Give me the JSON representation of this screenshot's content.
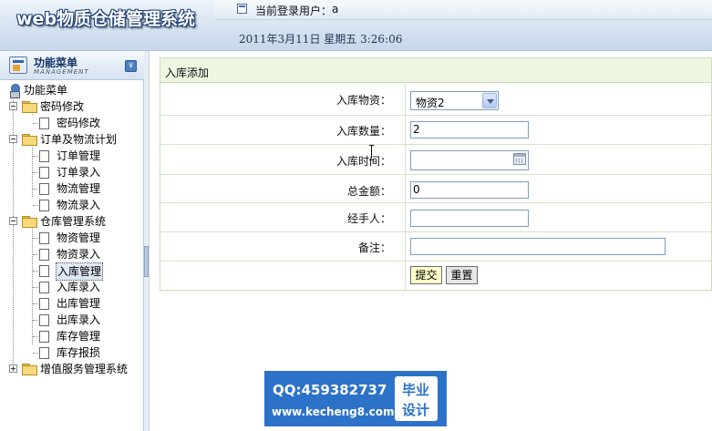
{
  "header": {
    "app_title": "web物质仓储管理系统",
    "current_user_label": "当前登录用户：",
    "current_user": "a",
    "datetime": "2011年3月11日  星期五  3:26:06"
  },
  "sidebar": {
    "menu_title": "功能菜单",
    "menu_subtitle": "MANAGEMENT",
    "collapse_icon": "double-chevron-down-icon",
    "tree": {
      "root": "功能菜单",
      "groups": [
        {
          "label": "密码修改",
          "expanded": true,
          "items": [
            "密码修改"
          ]
        },
        {
          "label": "订单及物流计划",
          "expanded": true,
          "items": [
            "订单管理",
            "订单录入",
            "物流管理",
            "物流录入"
          ]
        },
        {
          "label": "仓库管理系统",
          "expanded": true,
          "items": [
            "物资管理",
            "物资录入",
            "入库管理",
            "入库录入",
            "出库管理",
            "出库录入",
            "库存管理",
            "库存报损"
          ],
          "selected_item": "入库管理"
        },
        {
          "label": "增值服务管理系统",
          "expanded": false,
          "items": []
        }
      ]
    }
  },
  "form": {
    "panel_title": "入库添加",
    "fields": {
      "stock_item": {
        "label": "入库物资：",
        "value": "物资2"
      },
      "quantity": {
        "label": "入库数量：",
        "value": "2"
      },
      "in_time": {
        "label": "入库时间：",
        "value": ""
      },
      "total_amount": {
        "label": "总金额：",
        "value": "0"
      },
      "handler": {
        "label": "经手人：",
        "value": ""
      },
      "remark": {
        "label": "备注：",
        "value": ""
      }
    },
    "submit_label": "提交",
    "reset_label": "重置"
  },
  "watermark": {
    "qq": "QQ:459382737",
    "url": "www.kecheng8.com",
    "badge_line1": "毕业",
    "badge_line2": "设计"
  },
  "colors": {
    "header_bg": "#d6e3f1",
    "panel_header_bg": "#eef6e2",
    "panel_border": "#c9dcb9",
    "submit_bg": "#ffffc9",
    "watermark_bg": "#2d72c9"
  }
}
